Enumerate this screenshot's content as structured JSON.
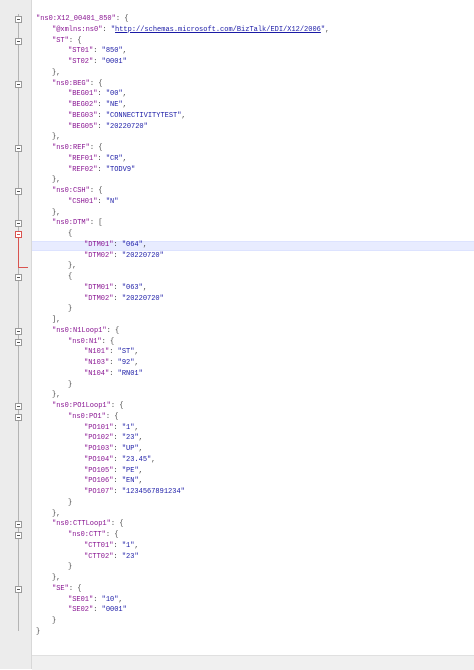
{
  "editor": {
    "lines": [
      {
        "indent": 0,
        "key": "ns0:X12_00401_850",
        "after": ": {"
      },
      {
        "indent": 1,
        "key": "@xmlns:ns0",
        "mid": ": ",
        "url": "http://schemas.microsoft.com/BizTalk/EDI/X12/2006",
        "after": ","
      },
      {
        "indent": 1,
        "key": "ST",
        "after": ": {"
      },
      {
        "indent": 2,
        "key": "ST01",
        "mid": ": ",
        "val": "850",
        "after": ","
      },
      {
        "indent": 2,
        "key": "ST02",
        "mid": ": ",
        "val": "0001"
      },
      {
        "indent": 1,
        "punct": "},"
      },
      {
        "indent": 1,
        "key": "ns0:BEG",
        "after": ": {"
      },
      {
        "indent": 2,
        "key": "BEG01",
        "mid": ": ",
        "val": "00",
        "after": ","
      },
      {
        "indent": 2,
        "key": "BEG02",
        "mid": ": ",
        "val": "NE",
        "after": ","
      },
      {
        "indent": 2,
        "key": "BEG03",
        "mid": ": ",
        "val": "CONNECTIVITYTEST",
        "after": ","
      },
      {
        "indent": 2,
        "key": "BEG05",
        "mid": ": ",
        "val": "20220720"
      },
      {
        "indent": 1,
        "punct": "},"
      },
      {
        "indent": 1,
        "key": "ns0:REF",
        "after": ": {"
      },
      {
        "indent": 2,
        "key": "REF01",
        "mid": ": ",
        "val": "CR",
        "after": ","
      },
      {
        "indent": 2,
        "key": "REF02",
        "mid": ": ",
        "val": "TODV9"
      },
      {
        "indent": 1,
        "punct": "},"
      },
      {
        "indent": 1,
        "key": "ns0:CSH",
        "after": ": {"
      },
      {
        "indent": 2,
        "key": "CSH01",
        "mid": ": ",
        "val": "N"
      },
      {
        "indent": 1,
        "punct": "},"
      },
      {
        "indent": 1,
        "key": "ns0:DTM",
        "after": ": ["
      },
      {
        "indent": 2,
        "punct": "{"
      },
      {
        "indent": 3,
        "key": "DTM01",
        "mid": ": ",
        "val": "064",
        "after": ","
      },
      {
        "indent": 3,
        "key": "DTM02",
        "mid": ": ",
        "val": "20220720"
      },
      {
        "indent": 2,
        "punct": "},"
      },
      {
        "indent": 2,
        "punct": "{"
      },
      {
        "indent": 3,
        "key": "DTM01",
        "mid": ": ",
        "val": "063",
        "after": ","
      },
      {
        "indent": 3,
        "key": "DTM02",
        "mid": ": ",
        "val": "20220720"
      },
      {
        "indent": 2,
        "punct": "}"
      },
      {
        "indent": 1,
        "punct": "],"
      },
      {
        "indent": 1,
        "key": "ns0:N1Loop1",
        "after": ": {"
      },
      {
        "indent": 2,
        "key": "ns0:N1",
        "after": ": {"
      },
      {
        "indent": 3,
        "key": "N101",
        "mid": ": ",
        "val": "ST",
        "after": ","
      },
      {
        "indent": 3,
        "key": "N103",
        "mid": ": ",
        "val": "92",
        "after": ","
      },
      {
        "indent": 3,
        "key": "N104",
        "mid": ": ",
        "val": "RN01"
      },
      {
        "indent": 2,
        "punct": "}"
      },
      {
        "indent": 1,
        "punct": "},"
      },
      {
        "indent": 1,
        "key": "ns0:PO1Loop1",
        "after": ": {"
      },
      {
        "indent": 2,
        "key": "ns0:PO1",
        "after": ": {"
      },
      {
        "indent": 3,
        "key": "PO101",
        "mid": ": ",
        "val": "1",
        "after": ","
      },
      {
        "indent": 3,
        "key": "PO102",
        "mid": ": ",
        "val": "23",
        "after": ","
      },
      {
        "indent": 3,
        "key": "PO103",
        "mid": ": ",
        "val": "UP",
        "after": ","
      },
      {
        "indent": 3,
        "key": "PO104",
        "mid": ": ",
        "val": "23.45",
        "after": ","
      },
      {
        "indent": 3,
        "key": "PO105",
        "mid": ": ",
        "val": "PE",
        "after": ","
      },
      {
        "indent": 3,
        "key": "PO106",
        "mid": ": ",
        "val": "EN",
        "after": ","
      },
      {
        "indent": 3,
        "key": "PO107",
        "mid": ": ",
        "val": "1234567891234"
      },
      {
        "indent": 2,
        "punct": "}"
      },
      {
        "indent": 1,
        "punct": "},"
      },
      {
        "indent": 1,
        "key": "ns0:CTTLoop1",
        "after": ": {"
      },
      {
        "indent": 2,
        "key": "ns0:CTT",
        "after": ": {"
      },
      {
        "indent": 3,
        "key": "CTT01",
        "mid": ": ",
        "val": "1",
        "after": ","
      },
      {
        "indent": 3,
        "key": "CTT02",
        "mid": ": ",
        "val": "23"
      },
      {
        "indent": 2,
        "punct": "}"
      },
      {
        "indent": 1,
        "punct": "},"
      },
      {
        "indent": 1,
        "key": "SE",
        "after": ": {"
      },
      {
        "indent": 2,
        "key": "SE01",
        "mid": ": ",
        "val": "10",
        "after": ","
      },
      {
        "indent": 2,
        "key": "SE02",
        "mid": ": ",
        "val": "0001"
      },
      {
        "indent": 1,
        "punct": "}"
      },
      {
        "indent": 0,
        "punct": "}"
      }
    ],
    "highlighted_line": 21,
    "active_fold_line": 20,
    "colors": {
      "key": "#881391",
      "string": "#1a1aa6",
      "highlight": "#e8ecff",
      "fold_active": "#d9534f"
    }
  }
}
